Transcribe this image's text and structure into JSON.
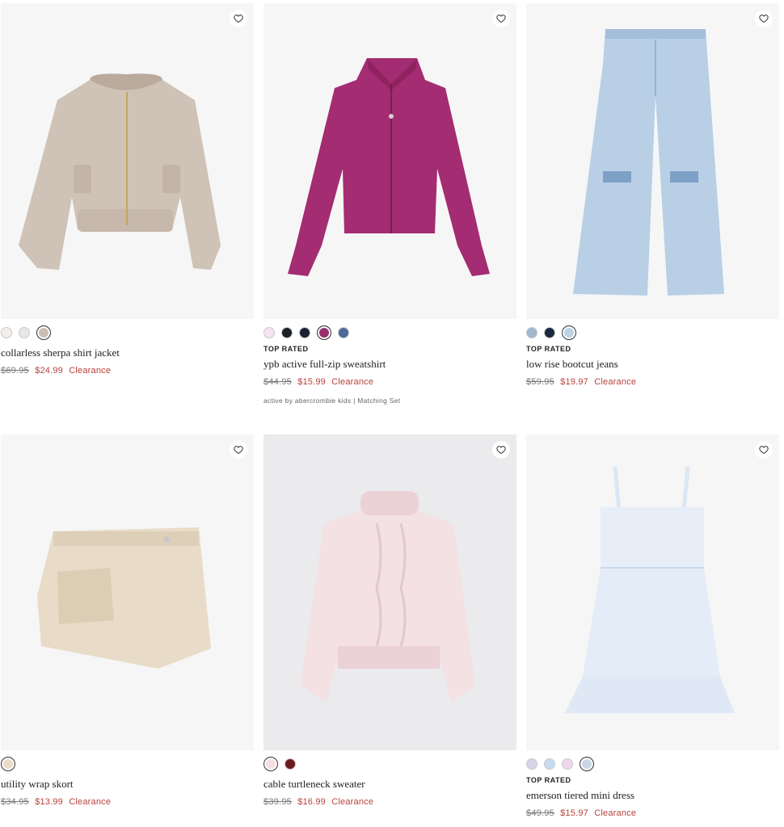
{
  "products": [
    {
      "name": "collarless sherpa shirt jacket",
      "badge": "",
      "old_price": "$69.95",
      "new_price": "$24.99",
      "sale_label": "Clearance",
      "subtitle": "",
      "swatches": [
        "#f3efea",
        "#e9e8e6",
        "#cdbdb1"
      ],
      "selected_swatch": 2
    },
    {
      "name": "ypb active full-zip sweatshirt",
      "badge": "TOP RATED",
      "old_price": "$44.95",
      "new_price": "$15.99",
      "sale_label": "Clearance",
      "subtitle": "active by abercrombie kids | Matching Set",
      "swatches": [
        "#f4e4f1",
        "#1d1f24",
        "#1b2136",
        "#9a2f6d",
        "#4b6a95"
      ],
      "selected_swatch": 3
    },
    {
      "name": "low rise bootcut jeans",
      "badge": "TOP RATED",
      "old_price": "$59.95",
      "new_price": "$19.97",
      "sale_label": "Clearance",
      "subtitle": "",
      "swatches": [
        "#9fb7cf",
        "#1a2740",
        "#bcd3e6"
      ],
      "selected_swatch": 2
    },
    {
      "name": "utility wrap skort",
      "badge": "",
      "old_price": "$34.95",
      "new_price": "$13.99",
      "sale_label": "Clearance",
      "subtitle": "",
      "swatches": [
        "#ebdcc6"
      ],
      "selected_swatch": 0
    },
    {
      "name": "cable turtleneck sweater",
      "badge": "",
      "old_price": "$39.95",
      "new_price": "$16.99",
      "sale_label": "Clearance",
      "subtitle": "",
      "swatches": [
        "#f6dfe2",
        "#6b1c1f"
      ],
      "selected_swatch": 0
    },
    {
      "name": "emerson tiered mini dress",
      "badge": "TOP RATED",
      "old_price": "$49.95",
      "new_price": "$15.97",
      "sale_label": "Clearance",
      "subtitle": "",
      "swatches": [
        "#d8d4e8",
        "#c7dcee",
        "#efd6ea",
        "#c9d6e6"
      ],
      "selected_swatch": 3
    }
  ]
}
